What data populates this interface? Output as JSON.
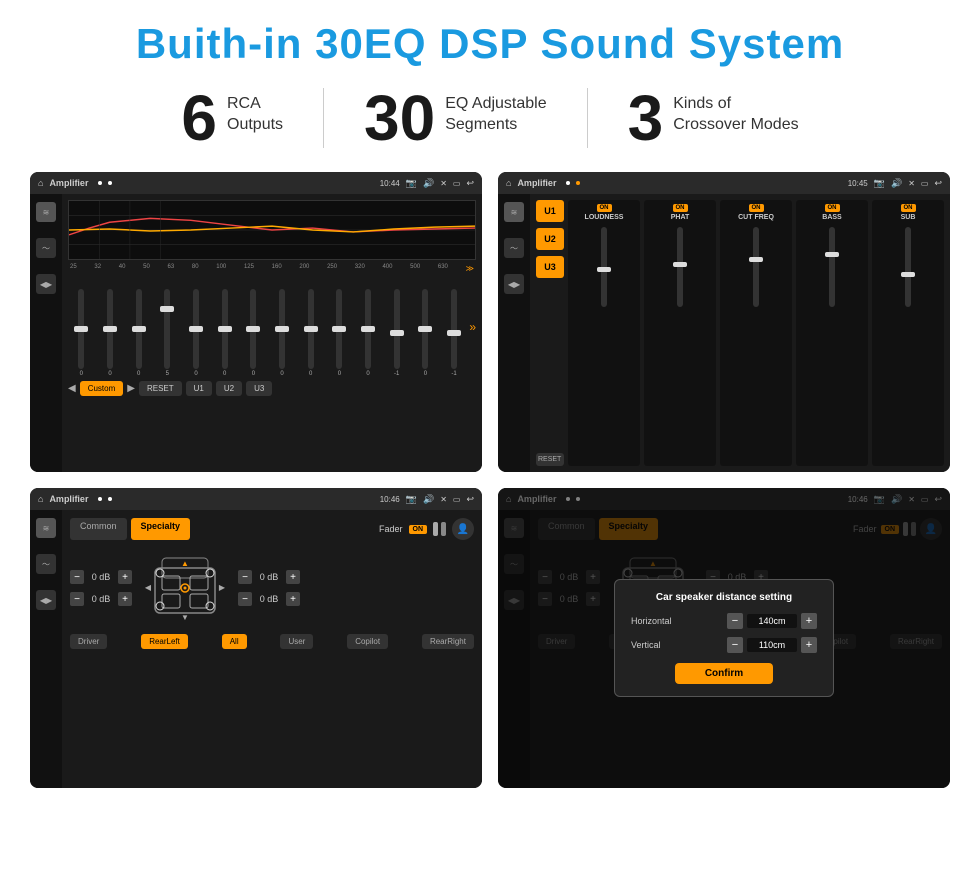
{
  "page": {
    "title": "Buith-in 30EQ DSP Sound System",
    "stats": [
      {
        "number": "6",
        "label_line1": "RCA",
        "label_line2": "Outputs"
      },
      {
        "number": "30",
        "label_line1": "EQ Adjustable",
        "label_line2": "Segments"
      },
      {
        "number": "3",
        "label_line1": "Kinds of",
        "label_line2": "Crossover Modes"
      }
    ]
  },
  "screen1": {
    "header": {
      "home": "⌂",
      "title": "Amplifier",
      "time": "10:44"
    },
    "freq_labels": [
      "25",
      "32",
      "40",
      "50",
      "63",
      "80",
      "100",
      "125",
      "160",
      "200",
      "250",
      "320",
      "400",
      "500",
      "630"
    ],
    "slider_values": [
      "0",
      "0",
      "0",
      "5",
      "0",
      "0",
      "0",
      "0",
      "0",
      "0",
      "0",
      "-1",
      "0",
      "-1"
    ],
    "preset": "Custom",
    "buttons": [
      "RESET",
      "U1",
      "U2",
      "U3"
    ]
  },
  "screen2": {
    "header": {
      "home": "⌂",
      "title": "Amplifier",
      "time": "10:45"
    },
    "u_buttons": [
      "U1",
      "U2",
      "U3"
    ],
    "channels": [
      {
        "on": true,
        "label": "LOUDNESS"
      },
      {
        "on": true,
        "label": "PHAT"
      },
      {
        "on": true,
        "label": "CUT FREQ"
      },
      {
        "on": true,
        "label": "BASS"
      },
      {
        "on": true,
        "label": "SUB"
      }
    ],
    "reset": "RESET"
  },
  "screen3": {
    "header": {
      "home": "⌂",
      "title": "Amplifier",
      "time": "10:46"
    },
    "tabs": [
      "Common",
      "Specialty"
    ],
    "fader_label": "Fader",
    "on_label": "ON",
    "db_left_top": "0 dB",
    "db_left_bottom": "0 dB",
    "db_right_top": "0 dB",
    "db_right_bottom": "0 dB",
    "bottom_labels": {
      "driver": "Driver",
      "rearleft": "RearLeft",
      "all": "All",
      "user": "User",
      "copilot": "Copilot",
      "rearright": "RearRight"
    }
  },
  "screen4": {
    "header": {
      "home": "⌂",
      "title": "Amplifier",
      "time": "10:46"
    },
    "tabs": [
      "Common",
      "Specialty"
    ],
    "dialog": {
      "title": "Car speaker distance setting",
      "horizontal_label": "Horizontal",
      "horizontal_value": "140cm",
      "vertical_label": "Vertical",
      "vertical_value": "110cm",
      "confirm_label": "Confirm"
    },
    "db_right_top": "0 dB",
    "db_right_bottom": "0 dB",
    "bottom_labels": {
      "driver": "Driver",
      "rearleft": "RearLeft",
      "all": "All",
      "user": "User",
      "copilot": "Copilot",
      "rearright": "RearRight"
    }
  },
  "icons": {
    "home": "⌂",
    "back": "↩",
    "volume": "🔊",
    "settings": "⚙",
    "eq": "≋",
    "wave": "〜",
    "speaker": "📢",
    "minus": "−",
    "plus": "+"
  }
}
